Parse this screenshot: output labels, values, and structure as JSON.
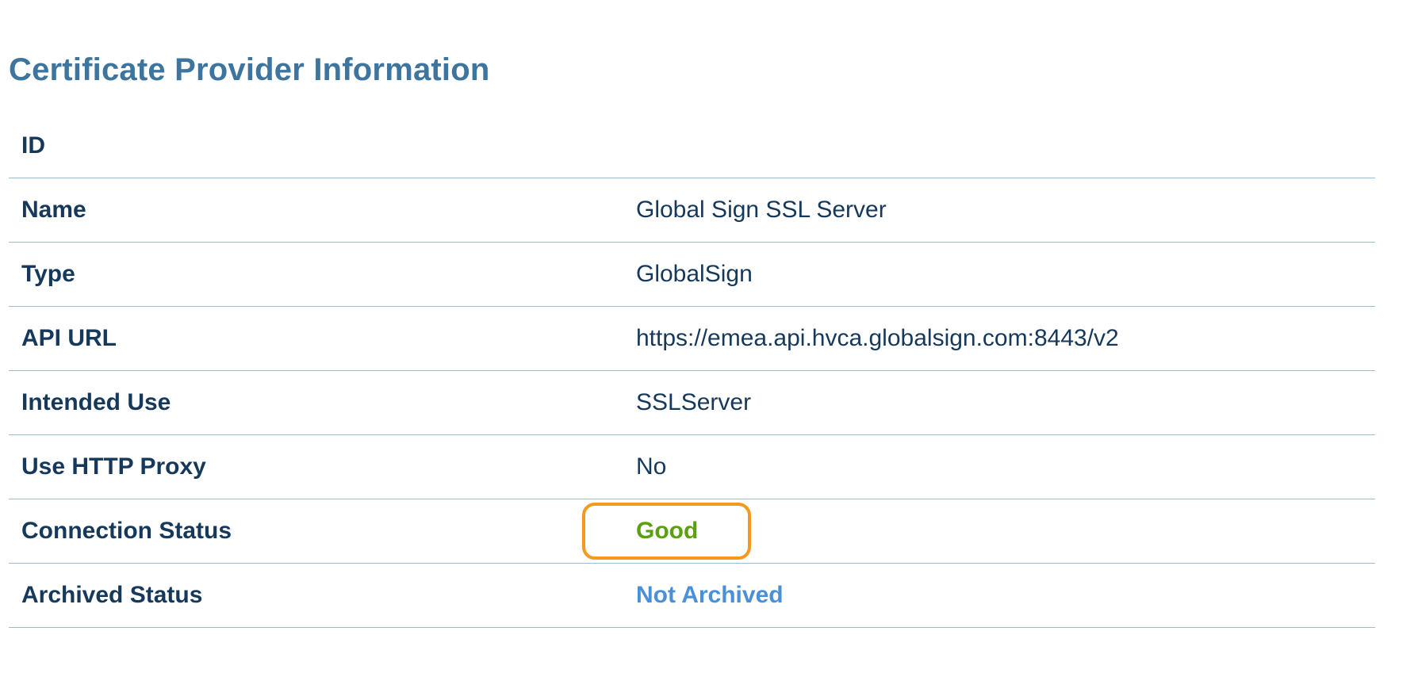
{
  "page": {
    "title": "Certificate Provider Information"
  },
  "colors": {
    "title": "#3e759e",
    "label": "#16395b",
    "status_good": "#5aa012",
    "status_archived": "#4a90d9",
    "highlight": "#f39a1e",
    "row_divider": "#9fbdd1"
  },
  "rows": [
    {
      "label": "ID",
      "value": ""
    },
    {
      "label": "Name",
      "value": "Global Sign SSL Server"
    },
    {
      "label": "Type",
      "value": "GlobalSign"
    },
    {
      "label": "API URL",
      "value": "https://emea.api.hvca.globalsign.com:8443/v2"
    },
    {
      "label": "Intended Use",
      "value": "SSLServer"
    },
    {
      "label": "Use HTTP Proxy",
      "value": "No"
    },
    {
      "label": "Connection Status",
      "value": "Good"
    },
    {
      "label": "Archived Status",
      "value": "Not Archived"
    }
  ]
}
